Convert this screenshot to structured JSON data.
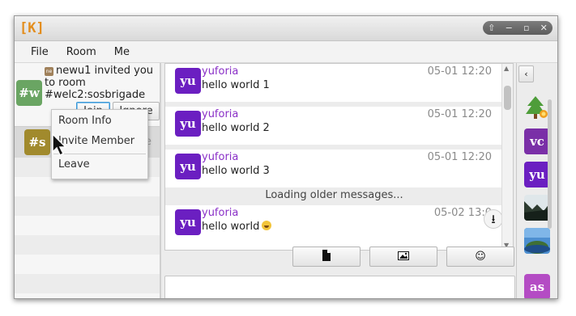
{
  "window": {
    "logo": "[K]",
    "controls": [
      "up-icon",
      "minimize-icon",
      "maximize-icon",
      "close-icon"
    ]
  },
  "menu": [
    "File",
    "Room",
    "Me"
  ],
  "invite": {
    "avatar_text": "#w",
    "badge_text": "ne",
    "message": "newu1 invited you to room #welc2:sosbrigade",
    "join_label": "Join",
    "ignore_label": "Ignore"
  },
  "rooms": [
    {
      "avatar_text": "#s",
      "trailing": "e"
    }
  ],
  "context_menu": {
    "items": [
      "Room Info",
      "Invite Member",
      "Leave"
    ]
  },
  "messages": [
    {
      "avatar": "yu",
      "user": "yuforia",
      "time": "05-01 12:20",
      "body": "hello world 1"
    },
    {
      "avatar": "yu",
      "user": "yuforia",
      "time": "05-01 12:20",
      "body": "hello world 2"
    },
    {
      "avatar": "yu",
      "user": "yuforia",
      "time": "05-01 12:20",
      "body": "hello world 3"
    },
    {
      "avatar": "yu",
      "user": "yuforia",
      "time": "05-02 13:0",
      "body": "hello world"
    }
  ],
  "loading_text": "Loading older messages...",
  "toolbar": {
    "file_icon": "file-icon",
    "image_icon": "image-icon",
    "emoji_icon": "emoji-icon",
    "emoji_glyph": "☺"
  },
  "member_panel": {
    "collapse_glyph": "‹",
    "members": [
      {
        "kind": "image",
        "name": "tree-avatar"
      },
      {
        "kind": "text",
        "text": "vc",
        "color": "#7a2fa7"
      },
      {
        "kind": "text",
        "text": "yu",
        "color": "#6b1fc1"
      },
      {
        "kind": "image",
        "name": "landscape-avatar"
      },
      {
        "kind": "image",
        "name": "sky-avatar"
      },
      {
        "kind": "text",
        "text": "as",
        "color": "#b44cc4"
      }
    ]
  },
  "colors": {
    "accent": "#3b99d8",
    "user_name": "#8a30c7",
    "avatar_purple": "#6b1fc1"
  }
}
